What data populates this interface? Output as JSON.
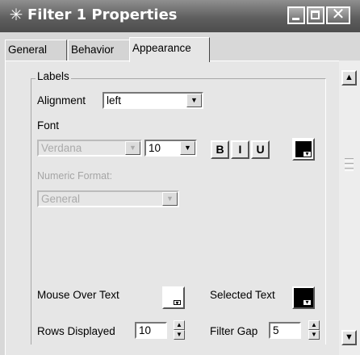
{
  "window": {
    "title": "Filter 1 Properties"
  },
  "tabs": [
    {
      "label": "General"
    },
    {
      "label": "Behavior"
    },
    {
      "label": "Appearance"
    }
  ],
  "labels_group": {
    "legend": "Labels",
    "alignment_label": "Alignment",
    "alignment_value": "left",
    "font_label": "Font",
    "font_value": "Verdana",
    "font_size_value": "10",
    "bold_label": "B",
    "italic_label": "I",
    "underline_label": "U",
    "numeric_format_label": "Numeric Format:",
    "numeric_format_value": "General",
    "mouse_over_text_label": "Mouse Over Text",
    "selected_text_label": "Selected Text",
    "rows_displayed_label": "Rows Displayed",
    "rows_displayed_value": "10",
    "filter_gap_label": "Filter Gap",
    "filter_gap_value": "5"
  },
  "colors": {
    "font_color": "#000000",
    "mouse_over_color": "#ffffff",
    "selected_text_color": "#000000"
  },
  "icons": {
    "app": "asterisk-icon",
    "dropdown": "chevron-down-icon"
  }
}
